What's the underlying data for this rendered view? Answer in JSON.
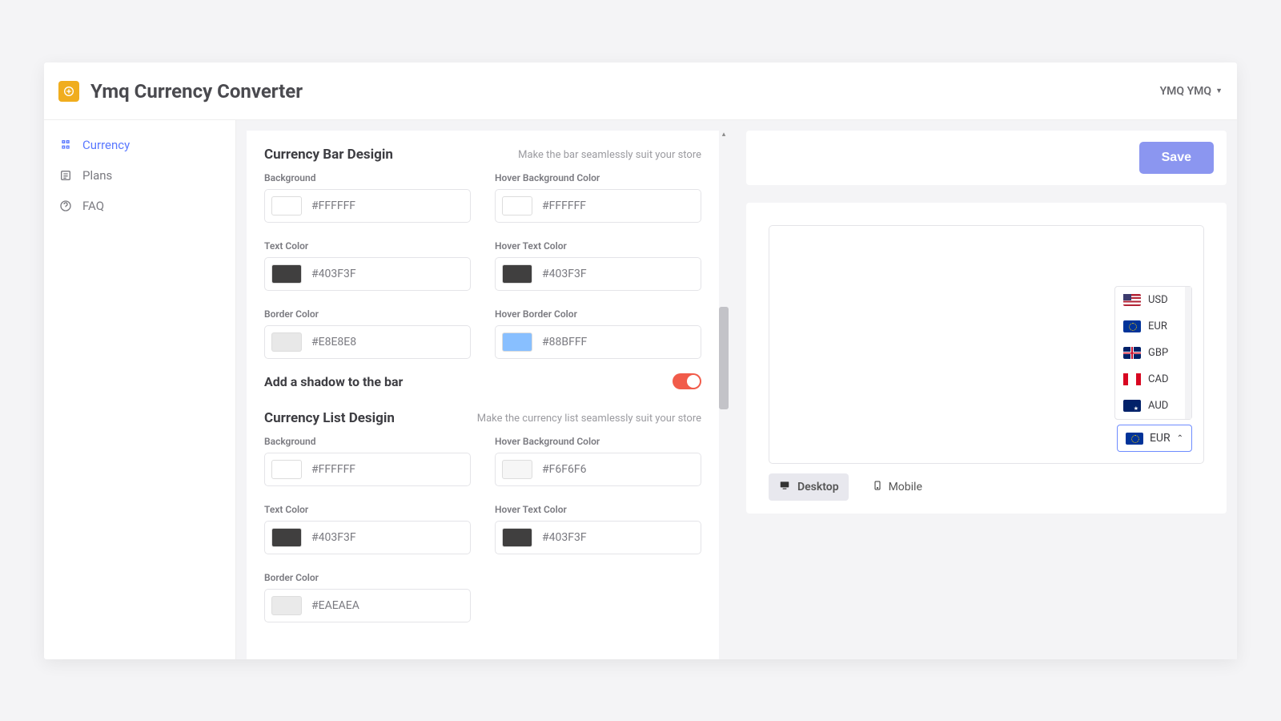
{
  "header": {
    "title": "Ymq Currency Converter",
    "user": "YMQ YMQ"
  },
  "sidebar": {
    "items": [
      {
        "label": "Currency"
      },
      {
        "label": "Plans"
      },
      {
        "label": "FAQ"
      }
    ]
  },
  "save_label": "Save",
  "bar": {
    "title": "Currency Bar Desigin",
    "subtitle": "Make the bar seamlessly suit your store",
    "fields": {
      "bg": {
        "label": "Background",
        "value": "#FFFFFF"
      },
      "hbg": {
        "label": "Hover Background Color",
        "value": "#FFFFFF"
      },
      "text": {
        "label": "Text Color",
        "value": "#403F3F"
      },
      "htext": {
        "label": "Hover Text Color",
        "value": "#403F3F"
      },
      "border": {
        "label": "Border Color",
        "value": "#E8E8E8"
      },
      "hborder": {
        "label": "Hover Border Color",
        "value": "#88BFFF"
      }
    },
    "shadow_label": "Add a shadow to the bar"
  },
  "list": {
    "title": "Currency List Desigin",
    "subtitle": "Make the currency list seamlessly suit your store",
    "fields": {
      "bg": {
        "label": "Background",
        "value": "#FFFFFF"
      },
      "hbg": {
        "label": "Hover Background Color",
        "value": "#F6F6F6"
      },
      "text": {
        "label": "Text Color",
        "value": "#403F3F"
      },
      "htext": {
        "label": "Hover Text Color",
        "value": "#403F3F"
      },
      "border": {
        "label": "Border Color",
        "value": "#EAEAEA"
      }
    }
  },
  "preview": {
    "currencies": [
      "USD",
      "EUR",
      "GBP",
      "CAD",
      "AUD"
    ],
    "selected": "EUR",
    "tabs": {
      "desktop": "Desktop",
      "mobile": "Mobile"
    }
  }
}
